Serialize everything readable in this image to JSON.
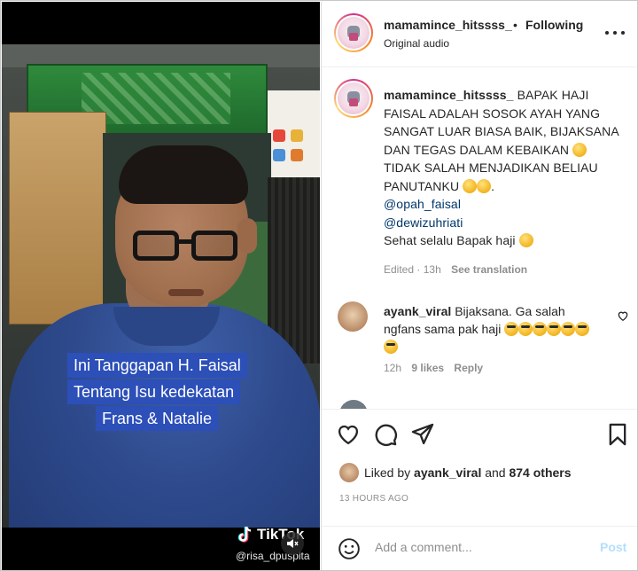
{
  "video": {
    "caption_lines": [
      "Ini Tanggapan H. Faisal",
      "Tentang Isu kedekatan",
      "Frans & Natalie"
    ],
    "watermark_brand": "TikTok",
    "watermark_handle": "@risa_dpuspita",
    "mute_icon": "speaker-muted-icon"
  },
  "header": {
    "username": "mamamince_hitssss_",
    "separator": "•",
    "follow_status": "Following",
    "audio": "Original audio",
    "more_icon": "more-options-icon"
  },
  "caption": {
    "username": "mamamince_hitssss_",
    "text_1": "BAPAK HAJI FAISAL ADALAH SOSOK AYAH YANG SANGAT LUAR BIASA BAIK, BIJAKSANA DAN TEGAS DALAM KEBAIKAN",
    "text_2": "TIDAK SALAH MENJADIKAN BELIAU PANUTANKU",
    "text_3": ".",
    "mention_1": "@opah_faisal",
    "mention_2": "@dewizuhriati",
    "text_4": "Sehat selalu Bapak haji",
    "edited": "Edited",
    "dot": "·",
    "time": "13h",
    "see_translation": "See translation"
  },
  "comment": {
    "username": "ayank_viral",
    "text": "Bijaksana. Ga salah ngfans sama pak haji",
    "time": "12h",
    "likes": "9 likes",
    "reply": "Reply"
  },
  "cut_comment": {
    "text": "..."
  },
  "likes": {
    "prefix": "Liked by",
    "user": "ayank_viral",
    "joiner": "and",
    "others": "874 others",
    "timestamp": "13 HOURS AGO"
  },
  "composer": {
    "placeholder": "Add a comment...",
    "post": "Post"
  },
  "colors": {
    "link": "#00376b",
    "muted": "#8e8e8e",
    "post_disabled": "#b2dffc",
    "caption_bg": "#2c4fb8"
  }
}
